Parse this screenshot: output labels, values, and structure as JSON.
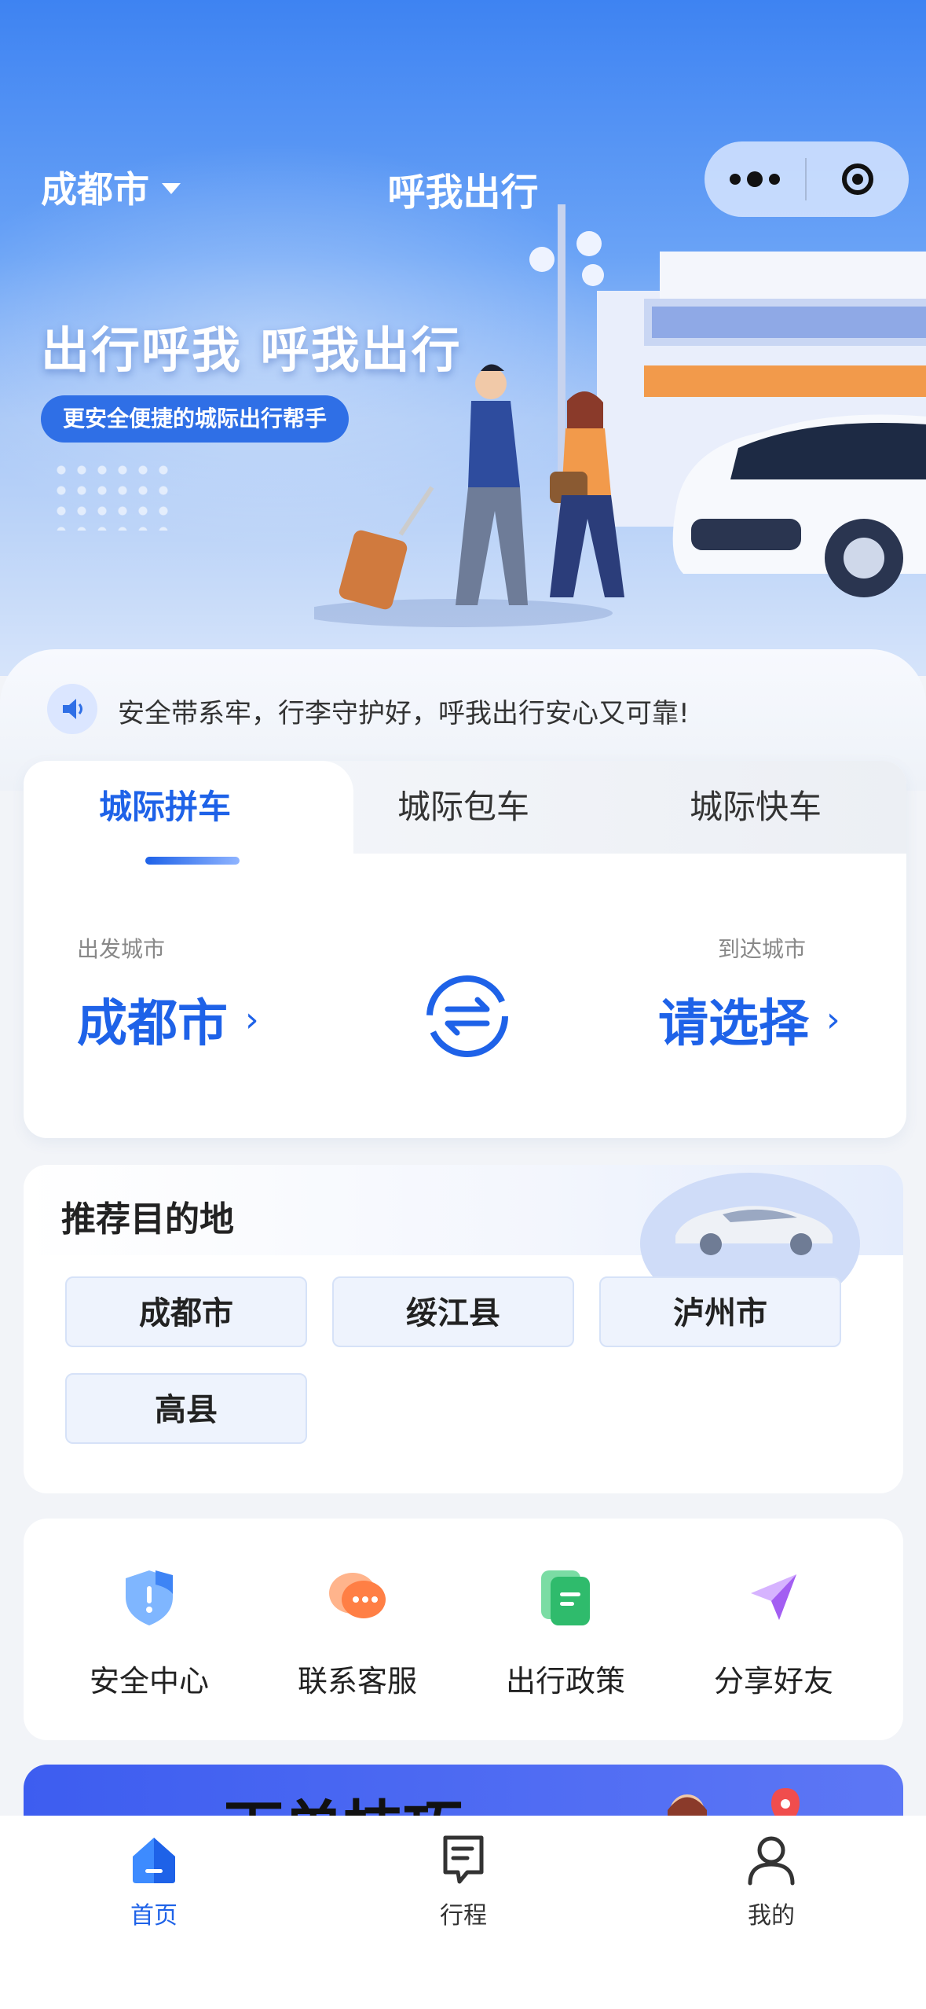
{
  "header": {
    "city": "成都市",
    "title": "呼我出行"
  },
  "hero": {
    "slogan": "出行呼我 呼我出行",
    "tagline": "更安全便捷的城际出行帮手"
  },
  "notice": {
    "text": "安全带系牢，行李守护好，呼我出行安心又可靠!"
  },
  "booking": {
    "tabs": [
      {
        "label": "城际拼车",
        "active": true
      },
      {
        "label": "城际包车",
        "active": false
      },
      {
        "label": "城际快车",
        "active": false
      }
    ],
    "from_label": "出发城市",
    "from_value": "成都市",
    "to_label": "到达城市",
    "to_value": "请选择"
  },
  "recommend": {
    "title": "推荐目的地",
    "chips": [
      "成都市",
      "绥江县",
      "泸州市",
      "高县"
    ]
  },
  "services": [
    {
      "label": "安全中心",
      "icon": "shield-icon",
      "color": "#6aa8ff"
    },
    {
      "label": "联系客服",
      "icon": "chat-icon",
      "color": "#ff8a5c"
    },
    {
      "label": "出行政策",
      "icon": "document-icon",
      "color": "#35c07a"
    },
    {
      "label": "分享好友",
      "icon": "share-icon",
      "color": "#b06cf5"
    }
  ],
  "banner": {
    "text": "下单技巧"
  },
  "nav": [
    {
      "label": "首页",
      "icon": "home-icon",
      "active": true
    },
    {
      "label": "行程",
      "icon": "trip-icon",
      "active": false
    },
    {
      "label": "我的",
      "icon": "profile-icon",
      "active": false
    }
  ],
  "colors": {
    "accent": "#1e62e8",
    "hero_top": "#3e83f2",
    "page_bg": "#f2f4f8"
  }
}
